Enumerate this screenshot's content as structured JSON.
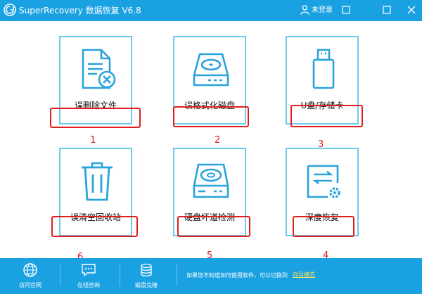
{
  "titlebar": {
    "title": "SuperRecovery 数据恢复 V6.8",
    "login": "未登录",
    "bg_color": "#1aa1e2"
  },
  "tiles": [
    {
      "label": "误删除文件",
      "icon": "deleted-file-icon",
      "number": "1"
    },
    {
      "label": "误格式化磁盘",
      "icon": "formatted-disk-icon",
      "number": "2"
    },
    {
      "label": "U盘/存储卡",
      "icon": "usb-drive-icon",
      "number": "3"
    },
    {
      "label": "误清空回收站",
      "icon": "recycle-bin-icon",
      "number": "6"
    },
    {
      "label": "硬盘坏道检测",
      "icon": "bad-sector-disk-icon",
      "number": "5"
    },
    {
      "label": "深度恢复",
      "icon": "deep-recovery-icon",
      "number": "4"
    }
  ],
  "footer": {
    "buttons": [
      {
        "label": "访问官网",
        "icon": "globe-icon"
      },
      {
        "label": "在线咨询",
        "icon": "chat-icon"
      },
      {
        "label": "磁盘克隆",
        "icon": "disk-clone-icon"
      }
    ],
    "hint": "如果您不知道如何使用软件，可以切换到",
    "guide_link": "向导模式"
  },
  "colors": {
    "accent": "#1aa1e2",
    "tile_border": "#6fc9ea",
    "highlight_red": "#e01e1e",
    "link_yellow": "#ffe05a"
  }
}
